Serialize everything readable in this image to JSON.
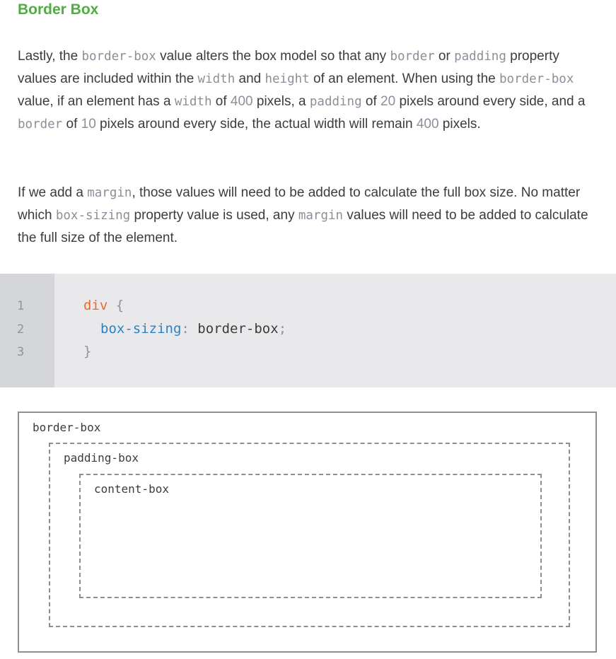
{
  "heading": "Border Box",
  "paragraph1": {
    "t1": "Lastly, the ",
    "c1": "border-box",
    "t2": " value alters the box model so that any ",
    "c2": "border",
    "t3": " or ",
    "c3": "padding",
    "t4": " property values are included within the ",
    "c4": "width",
    "t5": " and ",
    "c5": "height",
    "t6": " of an element. When using the ",
    "c6": "border-box",
    "t7": " value, if an element has a ",
    "c7": "width",
    "t8": " of ",
    "n1": "400",
    "t9": " pixels, a ",
    "c8": "padding",
    "t10": " of ",
    "n2": "20",
    "t11": " pixels around every side, and a ",
    "c9": "border",
    "t12": " of ",
    "n3": "10",
    "t13": " pixels around every side, the actual width will remain ",
    "n4": "400",
    "t14": " pixels."
  },
  "paragraph2": {
    "t1": "If we add a ",
    "c1": "margin",
    "t2": ", those values will need to be added to calculate the full box size. No matter which ",
    "c2": "box-sizing",
    "t3": " property value is used, any ",
    "c3": "margin",
    "t4": " values will need to be added to calculate the full size of the element."
  },
  "code": {
    "line_numbers": [
      "1",
      "2",
      "3"
    ],
    "selector": "div",
    "open_brace": "{",
    "property": "box-sizing",
    "colon": ":",
    "value": "border-box",
    "semicolon": ";",
    "close_brace": "}"
  },
  "diagram": {
    "border_label": "border-box",
    "padding_label": "padding-box",
    "content_label": "content-box"
  }
}
